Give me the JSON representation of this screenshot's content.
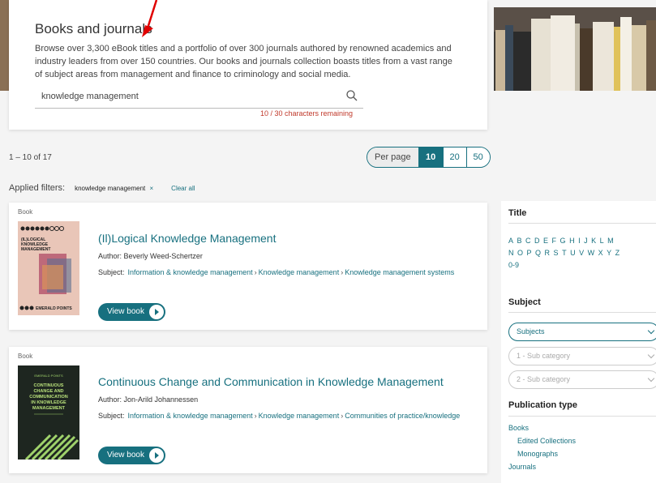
{
  "hero": {
    "title": "Books and journals",
    "description": "Browse over 3,300 eBook titles and a portfolio of over 300 journals authored by renowned academics and industry leaders from over 150 countries. Our books and journals collection boasts titles from a vast range of subject areas from management and finance to criminology and social media.",
    "search_value": "knowledge management",
    "chars_remaining": "10 / 30 characters remaining"
  },
  "results": {
    "count": "1 – 10 of 17",
    "per_page_label": "Per page",
    "per_page_options": [
      "10",
      "20",
      "50"
    ]
  },
  "filters": {
    "label": "Applied filters:",
    "chip": "knowledge management",
    "chip_close": "×",
    "clear_all": "Clear all"
  },
  "books": [
    {
      "type": "Book",
      "title": "(Il)Logical Knowledge Management",
      "author": "Author: Beverly Weed-Schertzer",
      "subject_label": "Subject:",
      "subjects": [
        "Information & knowledge management",
        "Knowledge management",
        "Knowledge management systems"
      ],
      "button": "View book",
      "cover_title": "(IL)LOGICAL KNOWLEDGE MANAGEMENT",
      "cover_publisher": "EMERALD POINTS"
    },
    {
      "type": "Book",
      "title": "Continuous Change and Communication in Knowledge Management",
      "author": "Author: Jon-Arild Johannessen",
      "subject_label": "Subject:",
      "subjects": [
        "Information & knowledge management",
        "Knowledge management",
        "Communities of practice/knowledge"
      ],
      "button": "View book",
      "cover_title": "CONTINUOUS CHANGE AND COMMUNICATION IN KNOWLEDGE MANAGEMENT"
    }
  ],
  "sidebar": {
    "title_heading": "Title",
    "alphabet": [
      "A",
      "B",
      "C",
      "D",
      "E",
      "F",
      "G",
      "H",
      "I",
      "J",
      "K",
      "L",
      "M",
      "N",
      "O",
      "P",
      "Q",
      "R",
      "S",
      "T",
      "U",
      "V",
      "W",
      "X",
      "Y",
      "Z",
      "0-9"
    ],
    "subject_heading": "Subject",
    "subjects_select": "Subjects",
    "sub1_select": "1 - Sub category",
    "sub2_select": "2 - Sub category",
    "pubtype_heading": "Publication type",
    "pubtypes": [
      "Books",
      "Edited Collections",
      "Monographs",
      "Journals"
    ]
  },
  "colors": {
    "accent": "#17707f",
    "arrow": "#e00000"
  }
}
